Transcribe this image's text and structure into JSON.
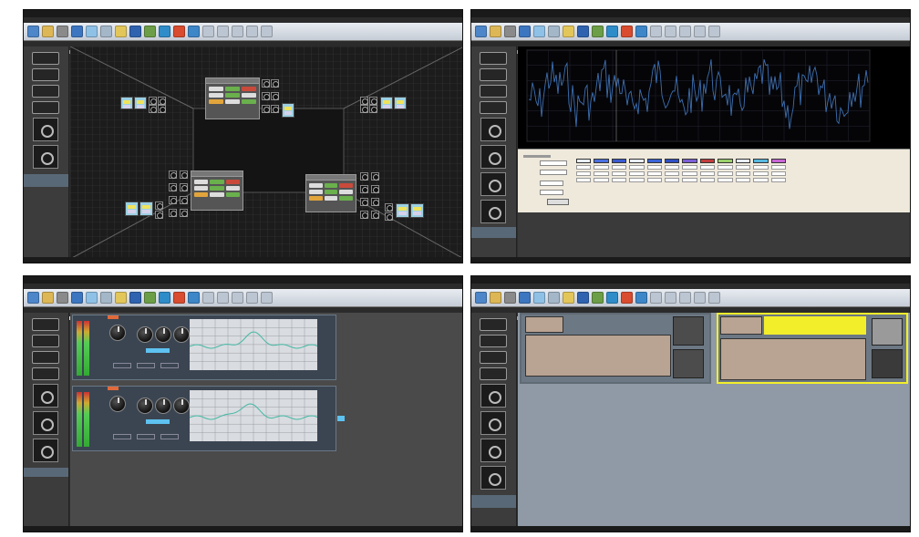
{
  "screens": [
    {
      "id": "room-3d-view",
      "title": "",
      "active_tab": 1
    },
    {
      "id": "parameter-waveform-view",
      "title": "",
      "active_tab": 2
    },
    {
      "id": "eq-view",
      "title": "",
      "active_tab": 3
    },
    {
      "id": "preset-view",
      "title": "",
      "active_tab": 4
    }
  ],
  "room": {
    "panels": [
      {
        "label": ""
      },
      {
        "label": ""
      },
      {
        "label": ""
      }
    ]
  },
  "wave": {
    "y_ticks": [
      "",
      "",
      "",
      "",
      "",
      "",
      ""
    ],
    "x_ticks": [
      "",
      "",
      "",
      "",
      "",
      "",
      "",
      "",
      "",
      "",
      "",
      "",
      "",
      "",
      "",
      "",
      ""
    ],
    "channel_colors": [
      "#e8eef8",
      "#4a6fe0",
      "#3a5ad0",
      "#e8eef8",
      "#3a63d6",
      "#2f4fc4",
      "#7b5ed6",
      "#c23c3c",
      "#9ad06a",
      "#e8eef8",
      "#58b8e0",
      "#c966d6"
    ],
    "trace_color": "#3d6fb0",
    "background": "#000000"
  },
  "eq": {
    "channels": [
      {
        "label": ""
      },
      {
        "label": ""
      }
    ],
    "curve_color": "#43b8a4",
    "accent": "#5ec2f0"
  },
  "presets": {
    "items": [
      {
        "label": "",
        "line1": "",
        "line2": "",
        "save_label": "",
        "load_label": "",
        "selected": false
      },
      {
        "label": "",
        "line1": "",
        "line2": "",
        "save_label": "",
        "load_label": "",
        "selected": true
      }
    ],
    "highlight": "#f2ee2a"
  },
  "icons": [
    "open-icon",
    "save-icon",
    "new-icon",
    "copy-icon",
    "screen-icon",
    "chip-icon",
    "folder-icon",
    "link-icon",
    "monitor-icon",
    "photo-icon",
    "plane-icon",
    "flag-icon",
    "grid-icon",
    "table-icon",
    "zoom-icon",
    "layout-icon",
    "help-icon"
  ]
}
